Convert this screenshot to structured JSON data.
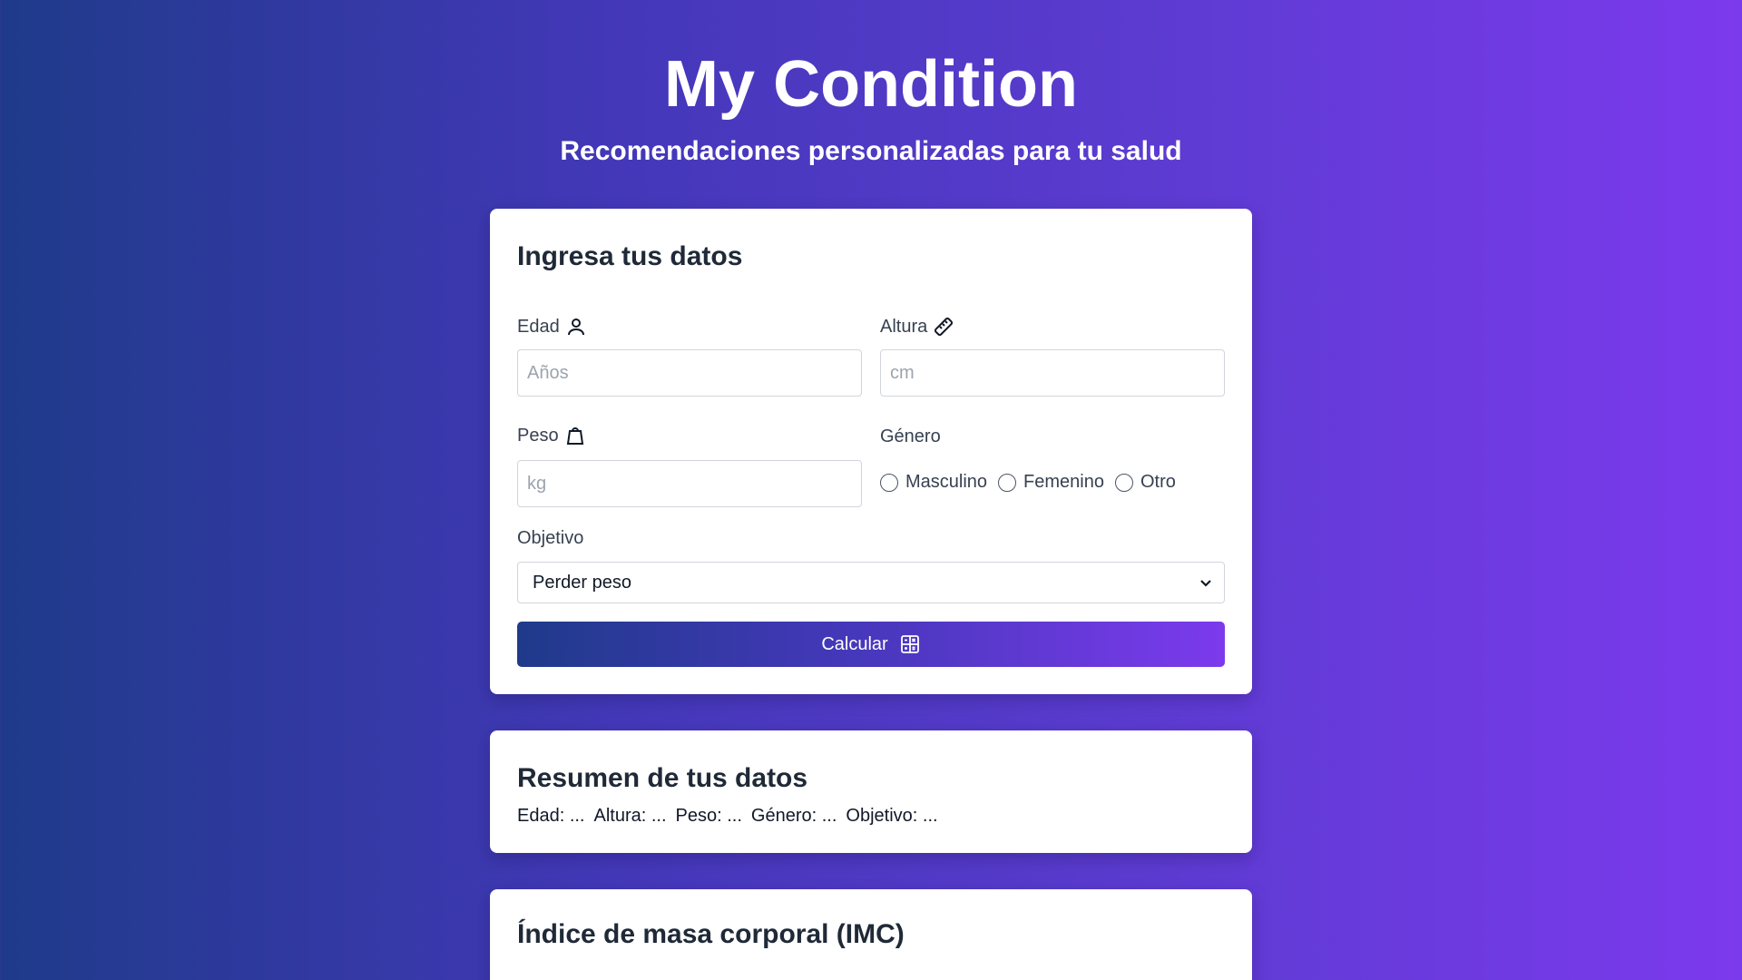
{
  "header": {
    "title": "My Condition",
    "subtitle": "Recomendaciones personalizadas para tu salud"
  },
  "form": {
    "title": "Ingresa tus datos",
    "age": {
      "label": "Edad",
      "icon": "person-icon",
      "placeholder": "Años",
      "value": ""
    },
    "height": {
      "label": "Altura",
      "icon": "ruler-icon",
      "placeholder": "cm",
      "value": ""
    },
    "weight": {
      "label": "Peso",
      "icon": "weight-icon",
      "placeholder": "kg",
      "value": ""
    },
    "gender": {
      "label": "Género",
      "options": [
        "Masculino",
        "Femenino",
        "Otro"
      ],
      "selected": null
    },
    "goal": {
      "label": "Objetivo",
      "selected": "Perder peso"
    },
    "submit_label": "Calcular",
    "submit_icon": "calculator-icon"
  },
  "summary": {
    "title": "Resumen de tus datos",
    "items": [
      "Edad: ...",
      "Altura: ...",
      "Peso: ...",
      "Género: ...",
      "Objetivo: ..."
    ]
  },
  "imc": {
    "title": "Índice de masa corporal (IMC)"
  },
  "colors": {
    "gradient_start": "#1f3a8a",
    "gradient_end": "#7c3aed",
    "card_bg": "#ffffff"
  }
}
